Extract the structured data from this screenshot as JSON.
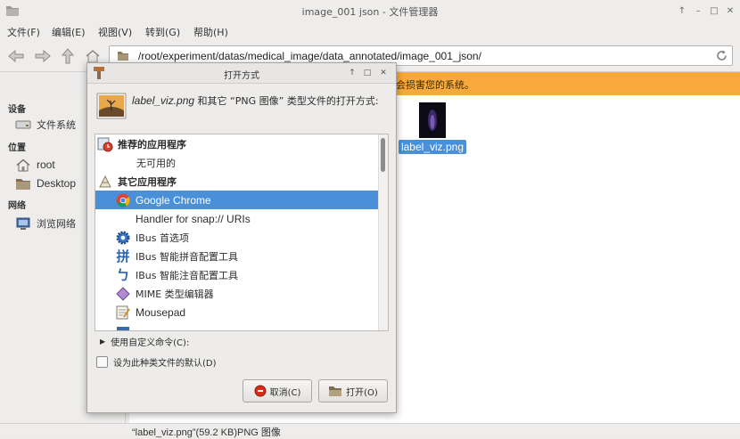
{
  "window": {
    "title": "image_001 json - 文件管理器"
  },
  "menu": [
    "文件(F)",
    "编辑(E)",
    "视图(V)",
    "转到(G)",
    "帮助(H)"
  ],
  "toolbar": {
    "path": "/root/experiment/datas/medical_image/data_annotated/image_001_json/"
  },
  "infobar": {
    "message": "会损害您的系统。"
  },
  "sidebar": {
    "sections": [
      {
        "title": "设备",
        "items": [
          {
            "label": "文件系统",
            "icon": "drive-icon"
          }
        ]
      },
      {
        "title": "位置",
        "items": [
          {
            "label": "root",
            "icon": "home-icon"
          },
          {
            "label": "Desktop",
            "icon": "folder-icon"
          }
        ]
      },
      {
        "title": "网络",
        "items": [
          {
            "label": "浏览网络",
            "icon": "network-icon"
          }
        ]
      }
    ]
  },
  "content": {
    "file": {
      "name": "label_viz.png"
    }
  },
  "status": {
    "text": "“label_viz.png”(59.2 KB)PNG 图像"
  },
  "dialog": {
    "title": "打开方式",
    "file_name": "label_viz.png",
    "description_mid": " 和其它 “PNG 图像” 类型文件的打开方式:",
    "recommended_header": "推荐的应用程序",
    "none_available": "无可用的",
    "other_header": "其它应用程序",
    "apps": [
      {
        "name": "Google Chrome",
        "icon": "chrome-icon",
        "selected": true
      },
      {
        "name": "Handler for snap:// URIs",
        "icon": "",
        "selected": false
      },
      {
        "name": "IBus 首选项",
        "icon": "gear-icon",
        "selected": false
      },
      {
        "name": "IBus 智能拼音配置工具",
        "icon": "pinyin-icon",
        "selected": false
      },
      {
        "name": "IBus 智能注音配置工具",
        "icon": "zhuyin-icon",
        "selected": false
      },
      {
        "name": "MIME 类型编辑器",
        "icon": "mime-icon",
        "selected": false
      },
      {
        "name": "Mousepad",
        "icon": "mousepad-icon",
        "selected": false
      }
    ],
    "custom_command": "使用自定义命令(C):",
    "set_default": "设为此种类文件的默认(D)",
    "cancel": "取消(C)",
    "open": "打开(O)"
  },
  "colors": {
    "accent": "#4a90d9",
    "warning": "#f7a93b"
  }
}
